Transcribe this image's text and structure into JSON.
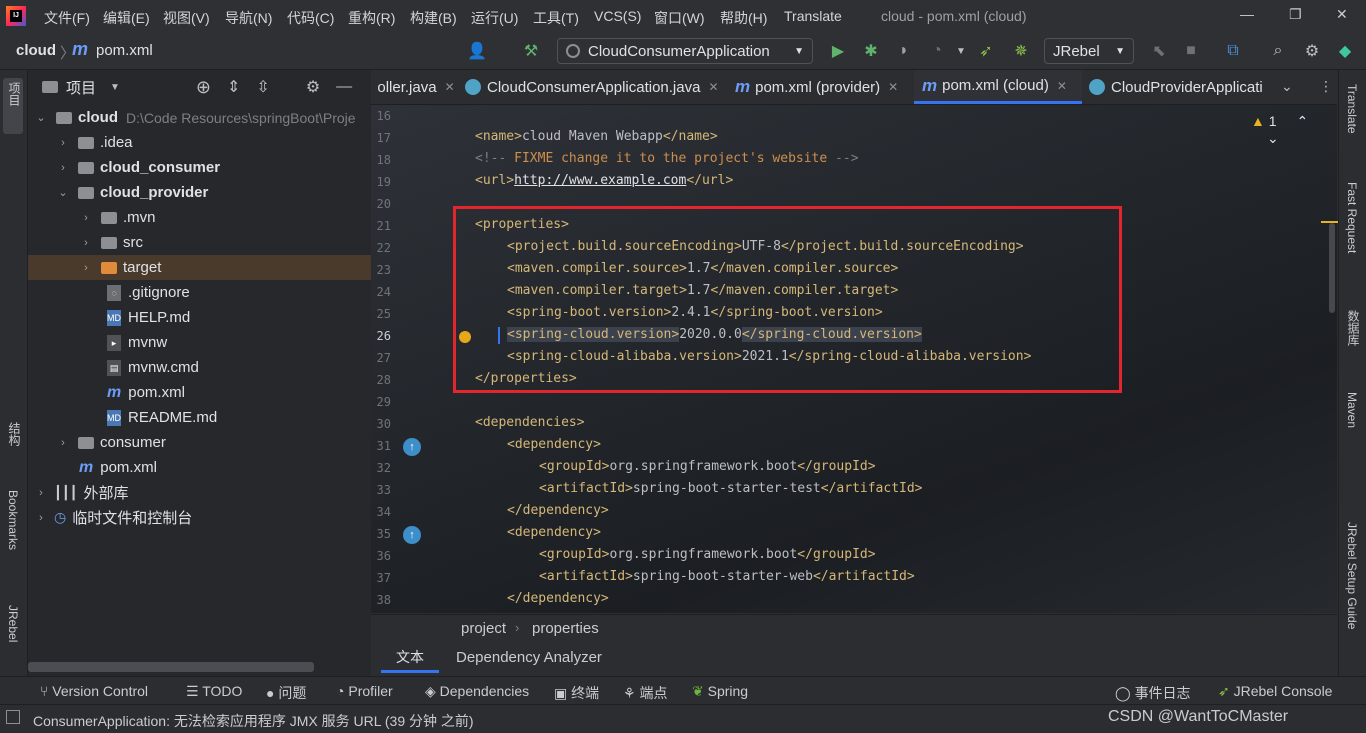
{
  "menu": {
    "items": [
      "文件(F)",
      "编辑(E)",
      "视图(V)",
      "导航(N)",
      "代码(C)",
      "重构(R)",
      "构建(B)",
      "运行(U)",
      "工具(T)",
      "VCS(S)",
      "窗口(W)",
      "帮助(H)",
      "Translate"
    ],
    "window_title": "cloud - pom.xml (cloud)"
  },
  "nav": {
    "crumb_project": "cloud",
    "crumb_file": "pom.xml",
    "run_config": "CloudConsumerApplication",
    "jrebel_combo": "JRebel"
  },
  "project_panel": {
    "title": "项目",
    "tree": [
      {
        "label": "cloud",
        "path": "D:\\Code Resources\\springBoot\\Proje",
        "bold": true
      },
      {
        "label": ".idea"
      },
      {
        "label": "cloud_consumer",
        "bold": true
      },
      {
        "label": "cloud_provider",
        "bold": true
      },
      {
        "label": ".mvn"
      },
      {
        "label": "src"
      },
      {
        "label": "target"
      },
      {
        "label": ".gitignore"
      },
      {
        "label": "HELP.md"
      },
      {
        "label": "mvnw"
      },
      {
        "label": "mvnw.cmd"
      },
      {
        "label": "pom.xml"
      },
      {
        "label": "README.md"
      },
      {
        "label": "consumer"
      },
      {
        "label": "pom.xml"
      },
      {
        "label": "外部库"
      },
      {
        "label": "临时文件和控制台"
      }
    ]
  },
  "left_strip": {
    "project": "项目",
    "structure": "结构",
    "bookmarks": "Bookmarks",
    "jrebel": "JRebel"
  },
  "right_strip": {
    "translate": "Translate",
    "fast_request": "Fast Request",
    "database": "数据库",
    "maven": "Maven",
    "jrebel_guide": "JRebel Setup Guide"
  },
  "tabs": [
    {
      "label": "oller.java"
    },
    {
      "label": "CloudConsumerApplication.java"
    },
    {
      "label": "pom.xml (provider)"
    },
    {
      "label": "pom.xml (cloud)",
      "active": true
    },
    {
      "label": "CloudProviderApplicati"
    }
  ],
  "editor": {
    "warning_count": "1",
    "line_numbers": [
      "16",
      "17",
      "18",
      "19",
      "20",
      "21",
      "22",
      "23",
      "24",
      "25",
      "26",
      "27",
      "28",
      "29",
      "30",
      "31",
      "32",
      "33",
      "34",
      "35",
      "36",
      "37",
      "38"
    ],
    "lines": {
      "l16a": "<name>",
      "l16b": "cloud Maven Webapp",
      "l16c": "</name>",
      "l17a": "<!-- ",
      "l17b": "FIXME change it to the project's website",
      "l17c": " -->",
      "l18a": "<url>",
      "l18b": "http://www.example.com",
      "l18c": "</url>",
      "l21": "<properties>",
      "l22a": "<project.build.sourceEncoding>",
      "l22b": "UTF-8",
      "l22c": "</project.build.sourceEncoding>",
      "l23a": "<maven.compiler.source>",
      "l23b": "1.7",
      "l23c": "</maven.compiler.source>",
      "l24a": "<maven.compiler.target>",
      "l24b": "1.7",
      "l24c": "</maven.compiler.target>",
      "l25a": "<spring-boot.version>",
      "l25b": "2.4.1",
      "l25c": "</spring-boot.version>",
      "l26a": "<spring-cloud.version>",
      "l26b": "2020.0.0",
      "l26c": "</spring-cloud.version>",
      "l27a": "<spring-cloud-alibaba.version>",
      "l27b": "2021.1",
      "l27c": "</spring-cloud-alibaba.version>",
      "l28": "</properties>",
      "l30": "<dependencies>",
      "l31": "<dependency>",
      "l32a": "<groupId>",
      "l32b": "org.springframework.boot",
      "l32c": "</groupId>",
      "l33a": "<artifactId>",
      "l33b": "spring-boot-starter-test",
      "l33c": "</artifactId>",
      "l34": "</dependency>",
      "l35": "<dependency>",
      "l36a": "<groupId>",
      "l36b": "org.springframework.boot",
      "l36c": "</groupId>",
      "l37a": "<artifactId>",
      "l37b": "spring-boot-starter-web",
      "l37c": "</artifactId>",
      "l38": "</dependency>"
    }
  },
  "breadcrumb": {
    "a": "project",
    "b": "properties"
  },
  "bottom_tabs": {
    "text": "文本",
    "dep_analyzer": "Dependency Analyzer"
  },
  "tool_windows": [
    "Version Control",
    "TODO",
    "问题",
    "Profiler",
    "Dependencies",
    "终端",
    "端点",
    "Spring",
    "事件日志",
    "JRebel Console"
  ],
  "status": {
    "message": "ConsumerApplication: 无法检索应用程序 JMX 服务 URL (39 分钟 之前)",
    "watermark": "CSDN @WantToCMaster"
  }
}
